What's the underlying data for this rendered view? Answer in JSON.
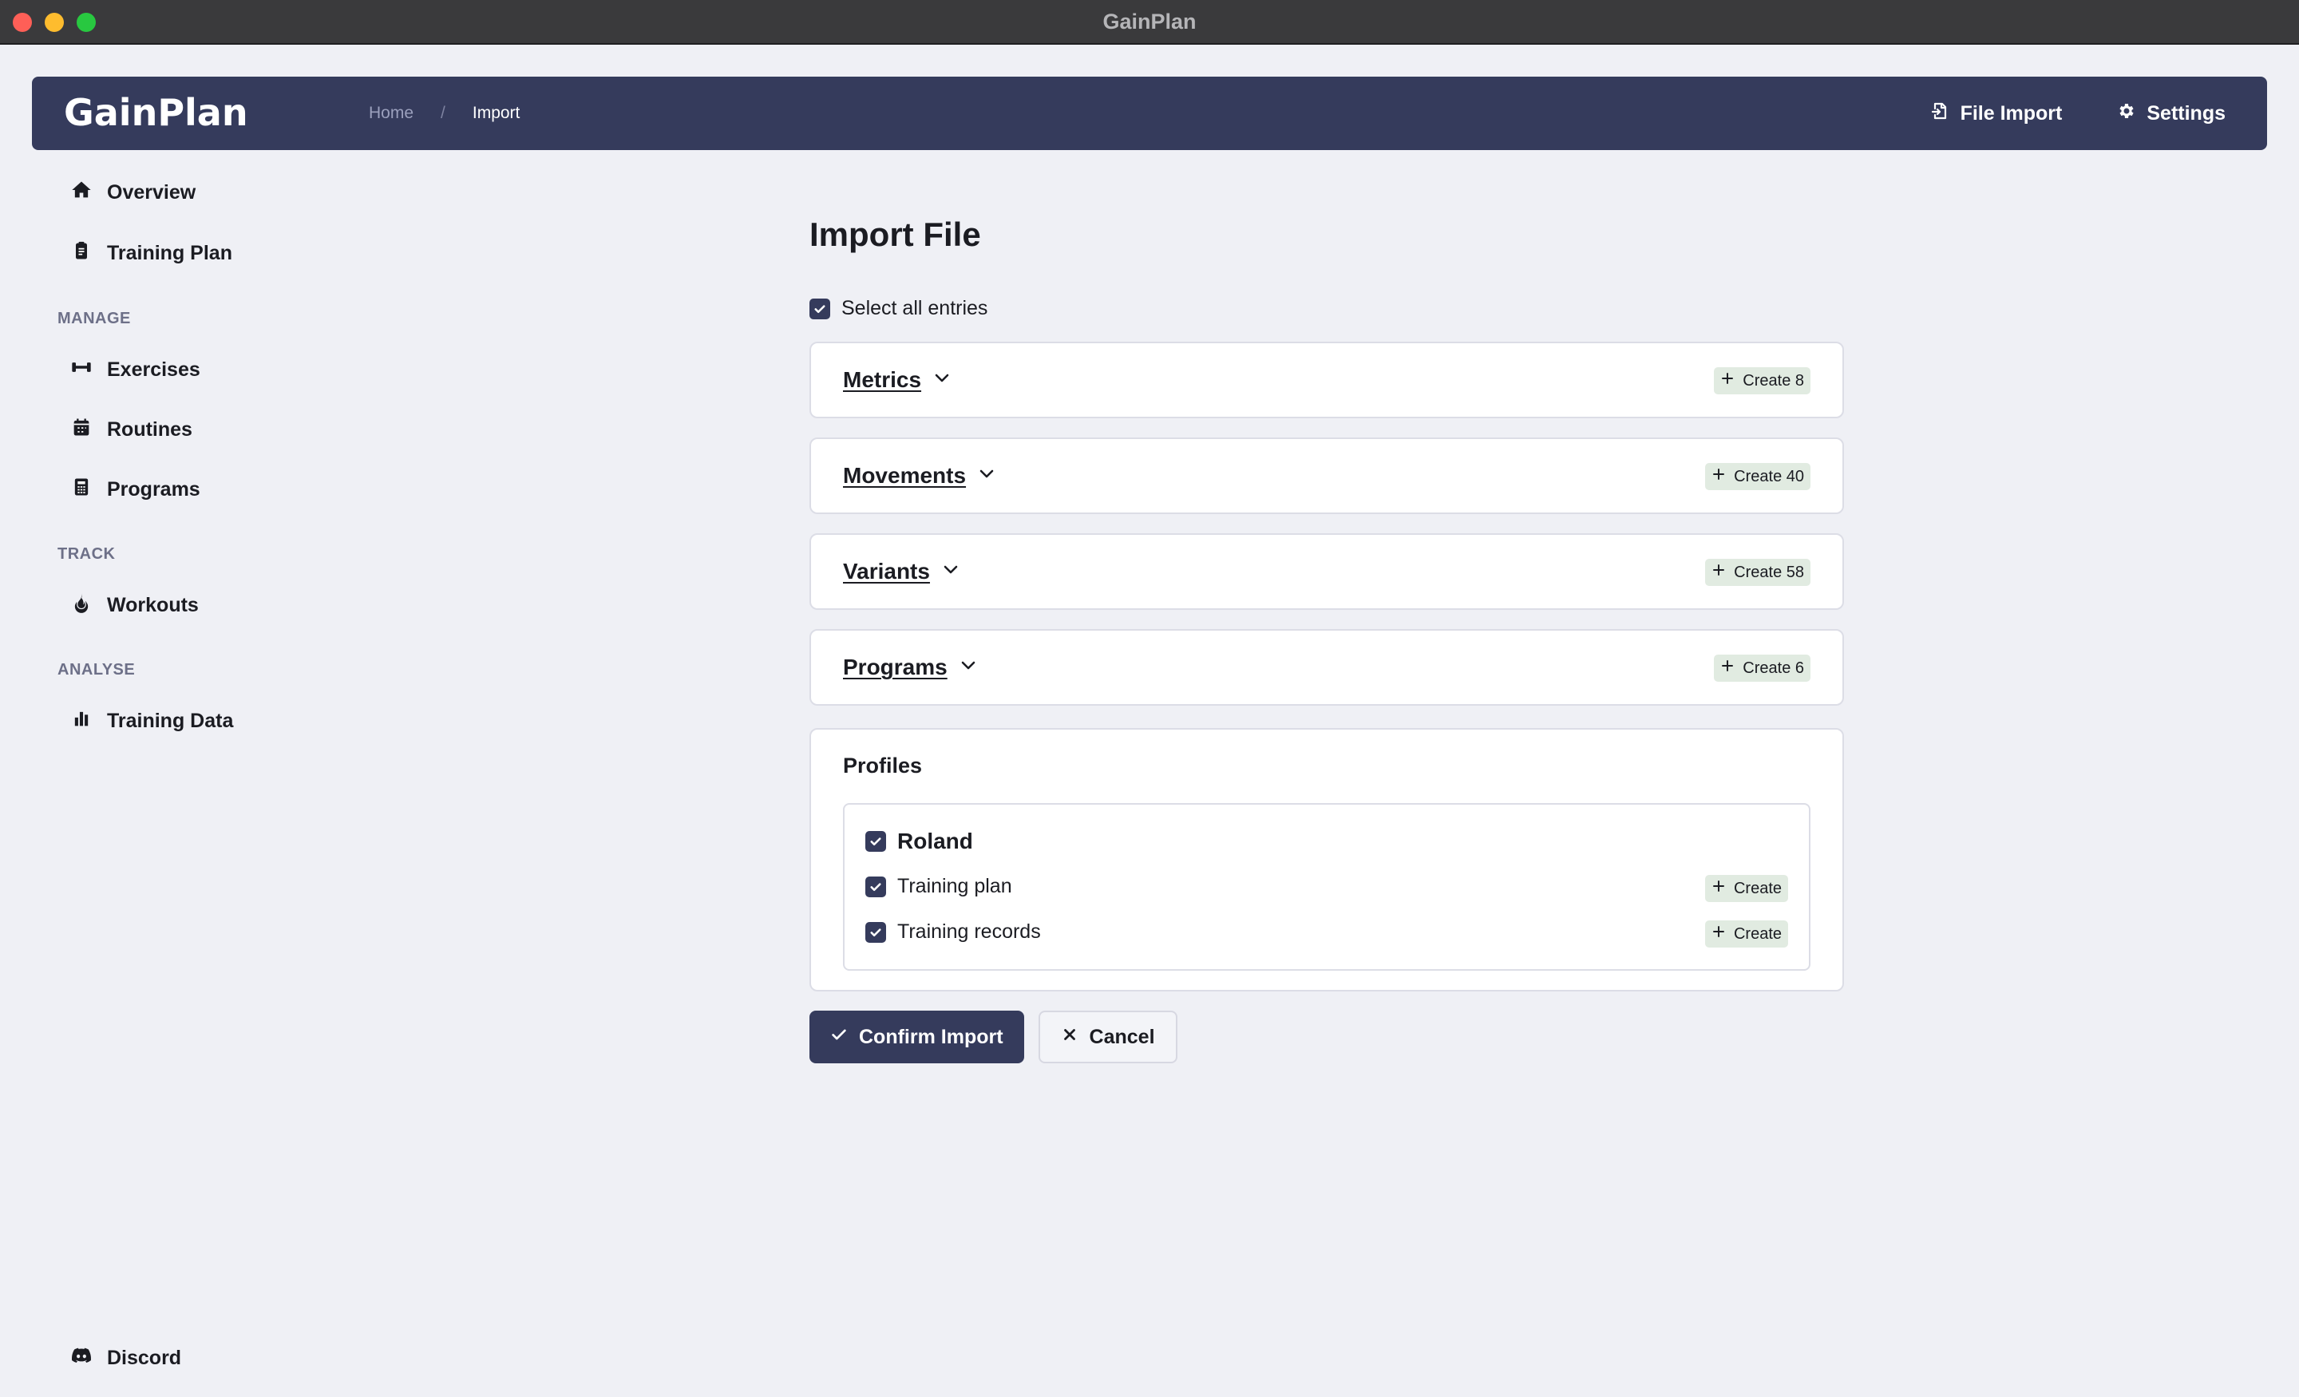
{
  "window": {
    "title": "GainPlan"
  },
  "header": {
    "logo": "GainPlan",
    "breadcrumb": {
      "home": "Home",
      "separator": "/",
      "current": "Import"
    },
    "file_import_label": "File Import",
    "settings_label": "Settings"
  },
  "sidebar": {
    "overview": "Overview",
    "training_plan": "Training Plan",
    "manage_heading": "MANAGE",
    "exercises": "Exercises",
    "routines": "Routines",
    "programs": "Programs",
    "track_heading": "TRACK",
    "workouts": "Workouts",
    "analyse_heading": "ANALYSE",
    "training_data": "Training Data",
    "discord": "Discord"
  },
  "main": {
    "title": "Import File",
    "select_all_label": "Select all entries",
    "sections": [
      {
        "title": "Metrics",
        "badge": "Create 8"
      },
      {
        "title": "Movements",
        "badge": "Create 40"
      },
      {
        "title": "Variants",
        "badge": "Create 58"
      },
      {
        "title": "Programs",
        "badge": "Create 6"
      }
    ],
    "profiles": {
      "title": "Profiles",
      "name": "Roland",
      "items": [
        {
          "label": "Training plan",
          "badge": "Create"
        },
        {
          "label": "Training records",
          "badge": "Create"
        }
      ]
    },
    "confirm_label": "Confirm Import",
    "cancel_label": "Cancel"
  },
  "colors": {
    "accent": "#353b5c",
    "background": "#eff0f5",
    "badge": "#e1ebe1"
  }
}
